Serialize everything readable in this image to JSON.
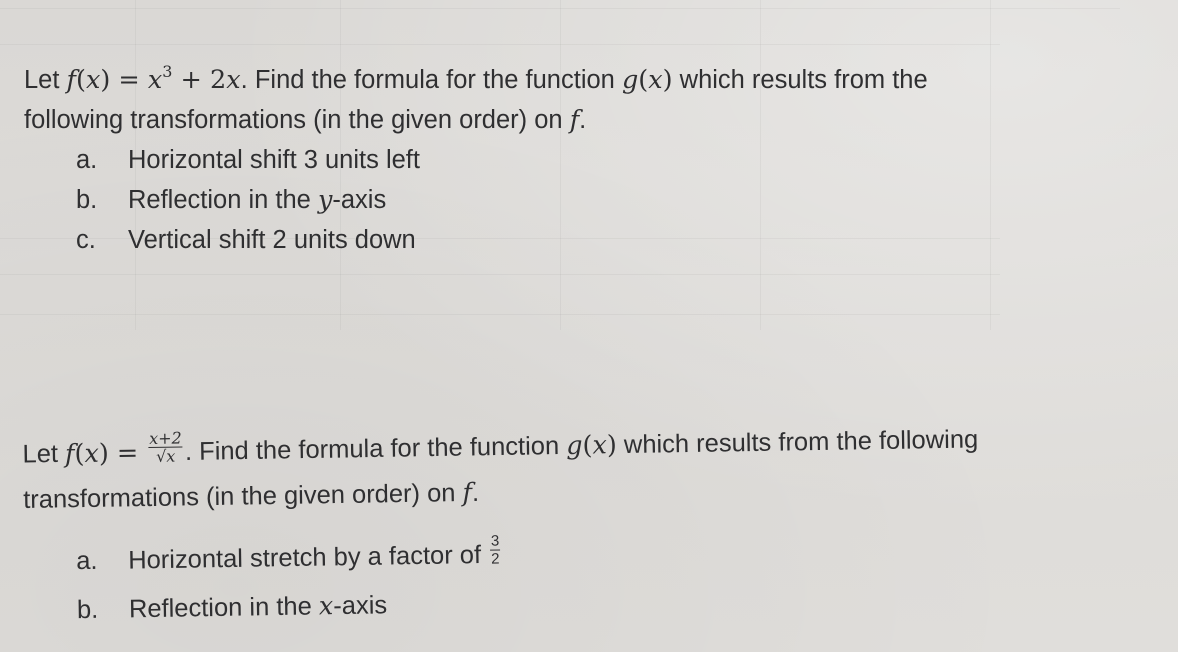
{
  "problems": [
    {
      "function_def": {
        "lhs_func": "f",
        "lhs_var": "x",
        "rhs": {
          "base": "x",
          "exponent": "3",
          "tail": " + 2",
          "tail_var": "x"
        }
      },
      "line1_suffix_a": ". Find the formula for the function ",
      "target_func": "g",
      "target_var": "x",
      "line1_suffix_b": " which results from the",
      "line2_text": "following transformations (in the given order) on ",
      "line2_func": "f",
      "line2_end": ".",
      "items": [
        {
          "marker": "a.",
          "text": "Horizontal shift 3 units left"
        },
        {
          "marker": "b.",
          "text_before": "Reflection in the ",
          "axis_var": "y",
          "text_after": "-axis"
        },
        {
          "marker": "c.",
          "text": "Vertical shift 2 units down"
        }
      ]
    },
    {
      "function_def": {
        "lhs_func": "f",
        "lhs_var": "x",
        "numerator": "x+2",
        "denominator_radical": "√",
        "denominator_var": "x"
      },
      "line1_suffix_a": ". Find the formula for the function ",
      "target_func": "g",
      "target_var": "x",
      "line1_suffix_b": " which results from the following",
      "line2_text": "transformations (in the given order) on ",
      "line2_func": "f",
      "line2_end": ".",
      "items": [
        {
          "marker": "a.",
          "text": "Horizontal stretch by a factor of ",
          "fraction": {
            "numerator": "3",
            "denominator": "2"
          }
        },
        {
          "marker": "b.",
          "text_before": "Reflection in the ",
          "axis_var": "x",
          "text_after": "-axis"
        }
      ]
    }
  ],
  "common": {
    "let": "Let ",
    "equals": " = ",
    "open_paren": "(",
    "close_paren": ")"
  }
}
